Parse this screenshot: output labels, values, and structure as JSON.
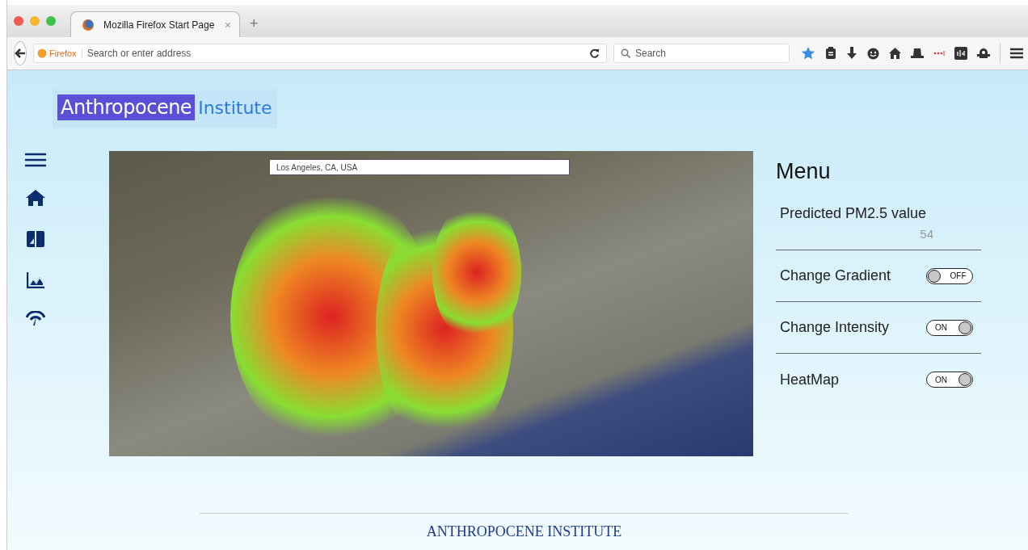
{
  "browser": {
    "tab": {
      "title": "Mozilla Firefox Start Page",
      "selected": true
    },
    "new_tab": "+",
    "close_tab": "×",
    "identity": "Firefox",
    "address": {
      "placeholder": "Search or enter address"
    },
    "search": {
      "placeholder": "Search"
    },
    "bookmarked": true
  },
  "logo": {
    "primary": "Anthropocene",
    "secondary": "Institute"
  },
  "map": {
    "search": {
      "value": "Los Angeles, CA, USA"
    }
  },
  "menu": {
    "title": "Menu",
    "items": [
      {
        "kind": "reading",
        "label": "Predicted PM2.5 value",
        "value": "54"
      },
      {
        "kind": "toggle",
        "label": "Change Gradient",
        "on": false,
        "state_label": "OFF"
      },
      {
        "kind": "toggle",
        "label": "Change Intensity",
        "on": true,
        "state_label": "ON"
      },
      {
        "kind": "toggle",
        "label": "HeatMap",
        "on": true,
        "state_label": "ON"
      }
    ]
  },
  "footer": {
    "text": "ANTHROPOCENE INSTITUTE"
  }
}
